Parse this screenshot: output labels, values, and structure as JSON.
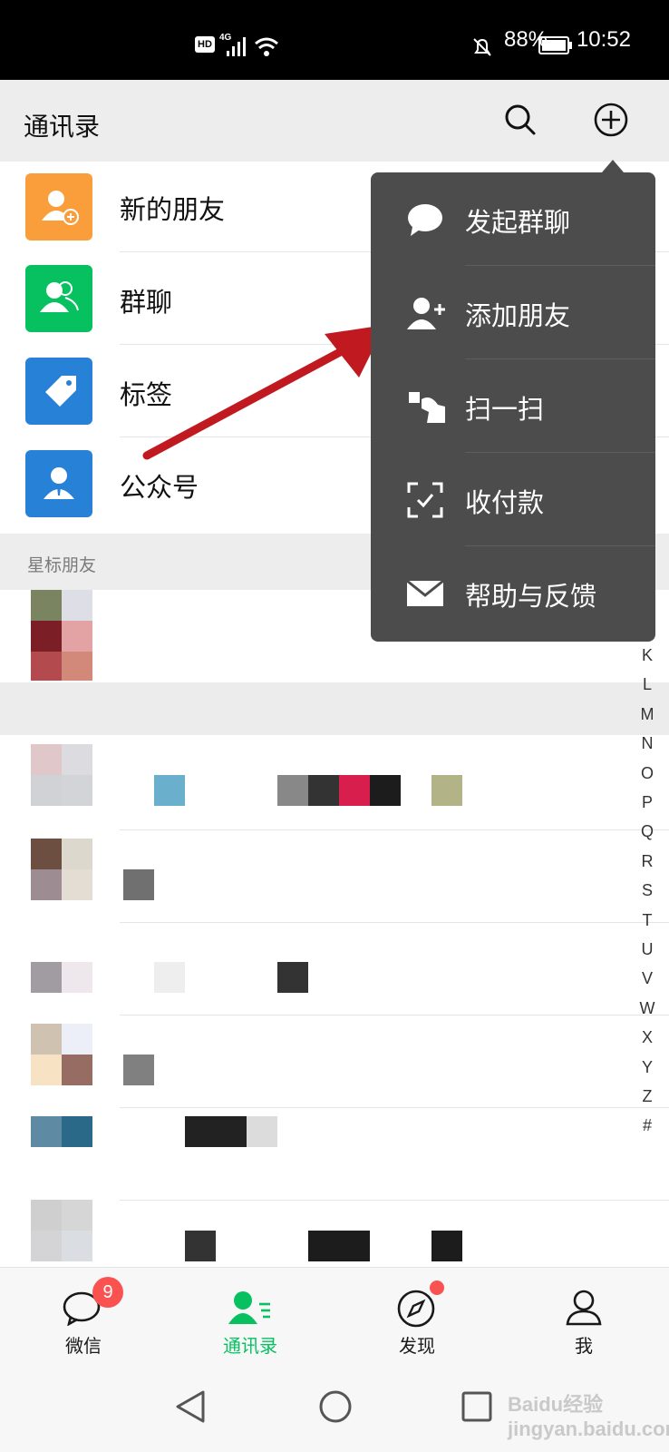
{
  "status_bar": {
    "hd": "HD",
    "network": "4G",
    "battery_percent": "88%",
    "time": "10:52"
  },
  "header": {
    "title": "通讯录"
  },
  "top_rows": [
    {
      "label": "新的朋友",
      "color": "#fa9d3b",
      "icon": "add-friend-icon"
    },
    {
      "label": "群聊",
      "color": "#07c160",
      "icon": "group-icon"
    },
    {
      "label": "标签",
      "color": "#2782d7",
      "icon": "tag-icon"
    },
    {
      "label": "公众号",
      "color": "#2782d7",
      "icon": "official-account-icon"
    }
  ],
  "section_starred": "星标朋友",
  "popup_menu": [
    {
      "label": "发起群聊",
      "icon": "chat-bubble-icon"
    },
    {
      "label": "添加朋友",
      "icon": "add-friend-icon"
    },
    {
      "label": "扫一扫",
      "icon": "scan-icon"
    },
    {
      "label": "收付款",
      "icon": "payment-scan-icon"
    },
    {
      "label": "帮助与反馈",
      "icon": "envelope-icon"
    }
  ],
  "index_letters": [
    "K",
    "L",
    "M",
    "N",
    "O",
    "P",
    "Q",
    "R",
    "S",
    "T",
    "U",
    "V",
    "W",
    "X",
    "Y",
    "Z",
    "#"
  ],
  "tabs": [
    {
      "label": "微信",
      "badge": "9",
      "icon": "chat-icon"
    },
    {
      "label": "通讯录",
      "active": true,
      "icon": "contacts-icon"
    },
    {
      "label": "发现",
      "dot": true,
      "icon": "compass-icon"
    },
    {
      "label": "我",
      "icon": "person-icon"
    }
  ],
  "colors": {
    "accent": "#07c160",
    "popup": "#4c4c4c",
    "badge": "#fa5151",
    "arrow": "#c0191f"
  },
  "watermark": "Baidu经验 jingyan.baidu.com"
}
